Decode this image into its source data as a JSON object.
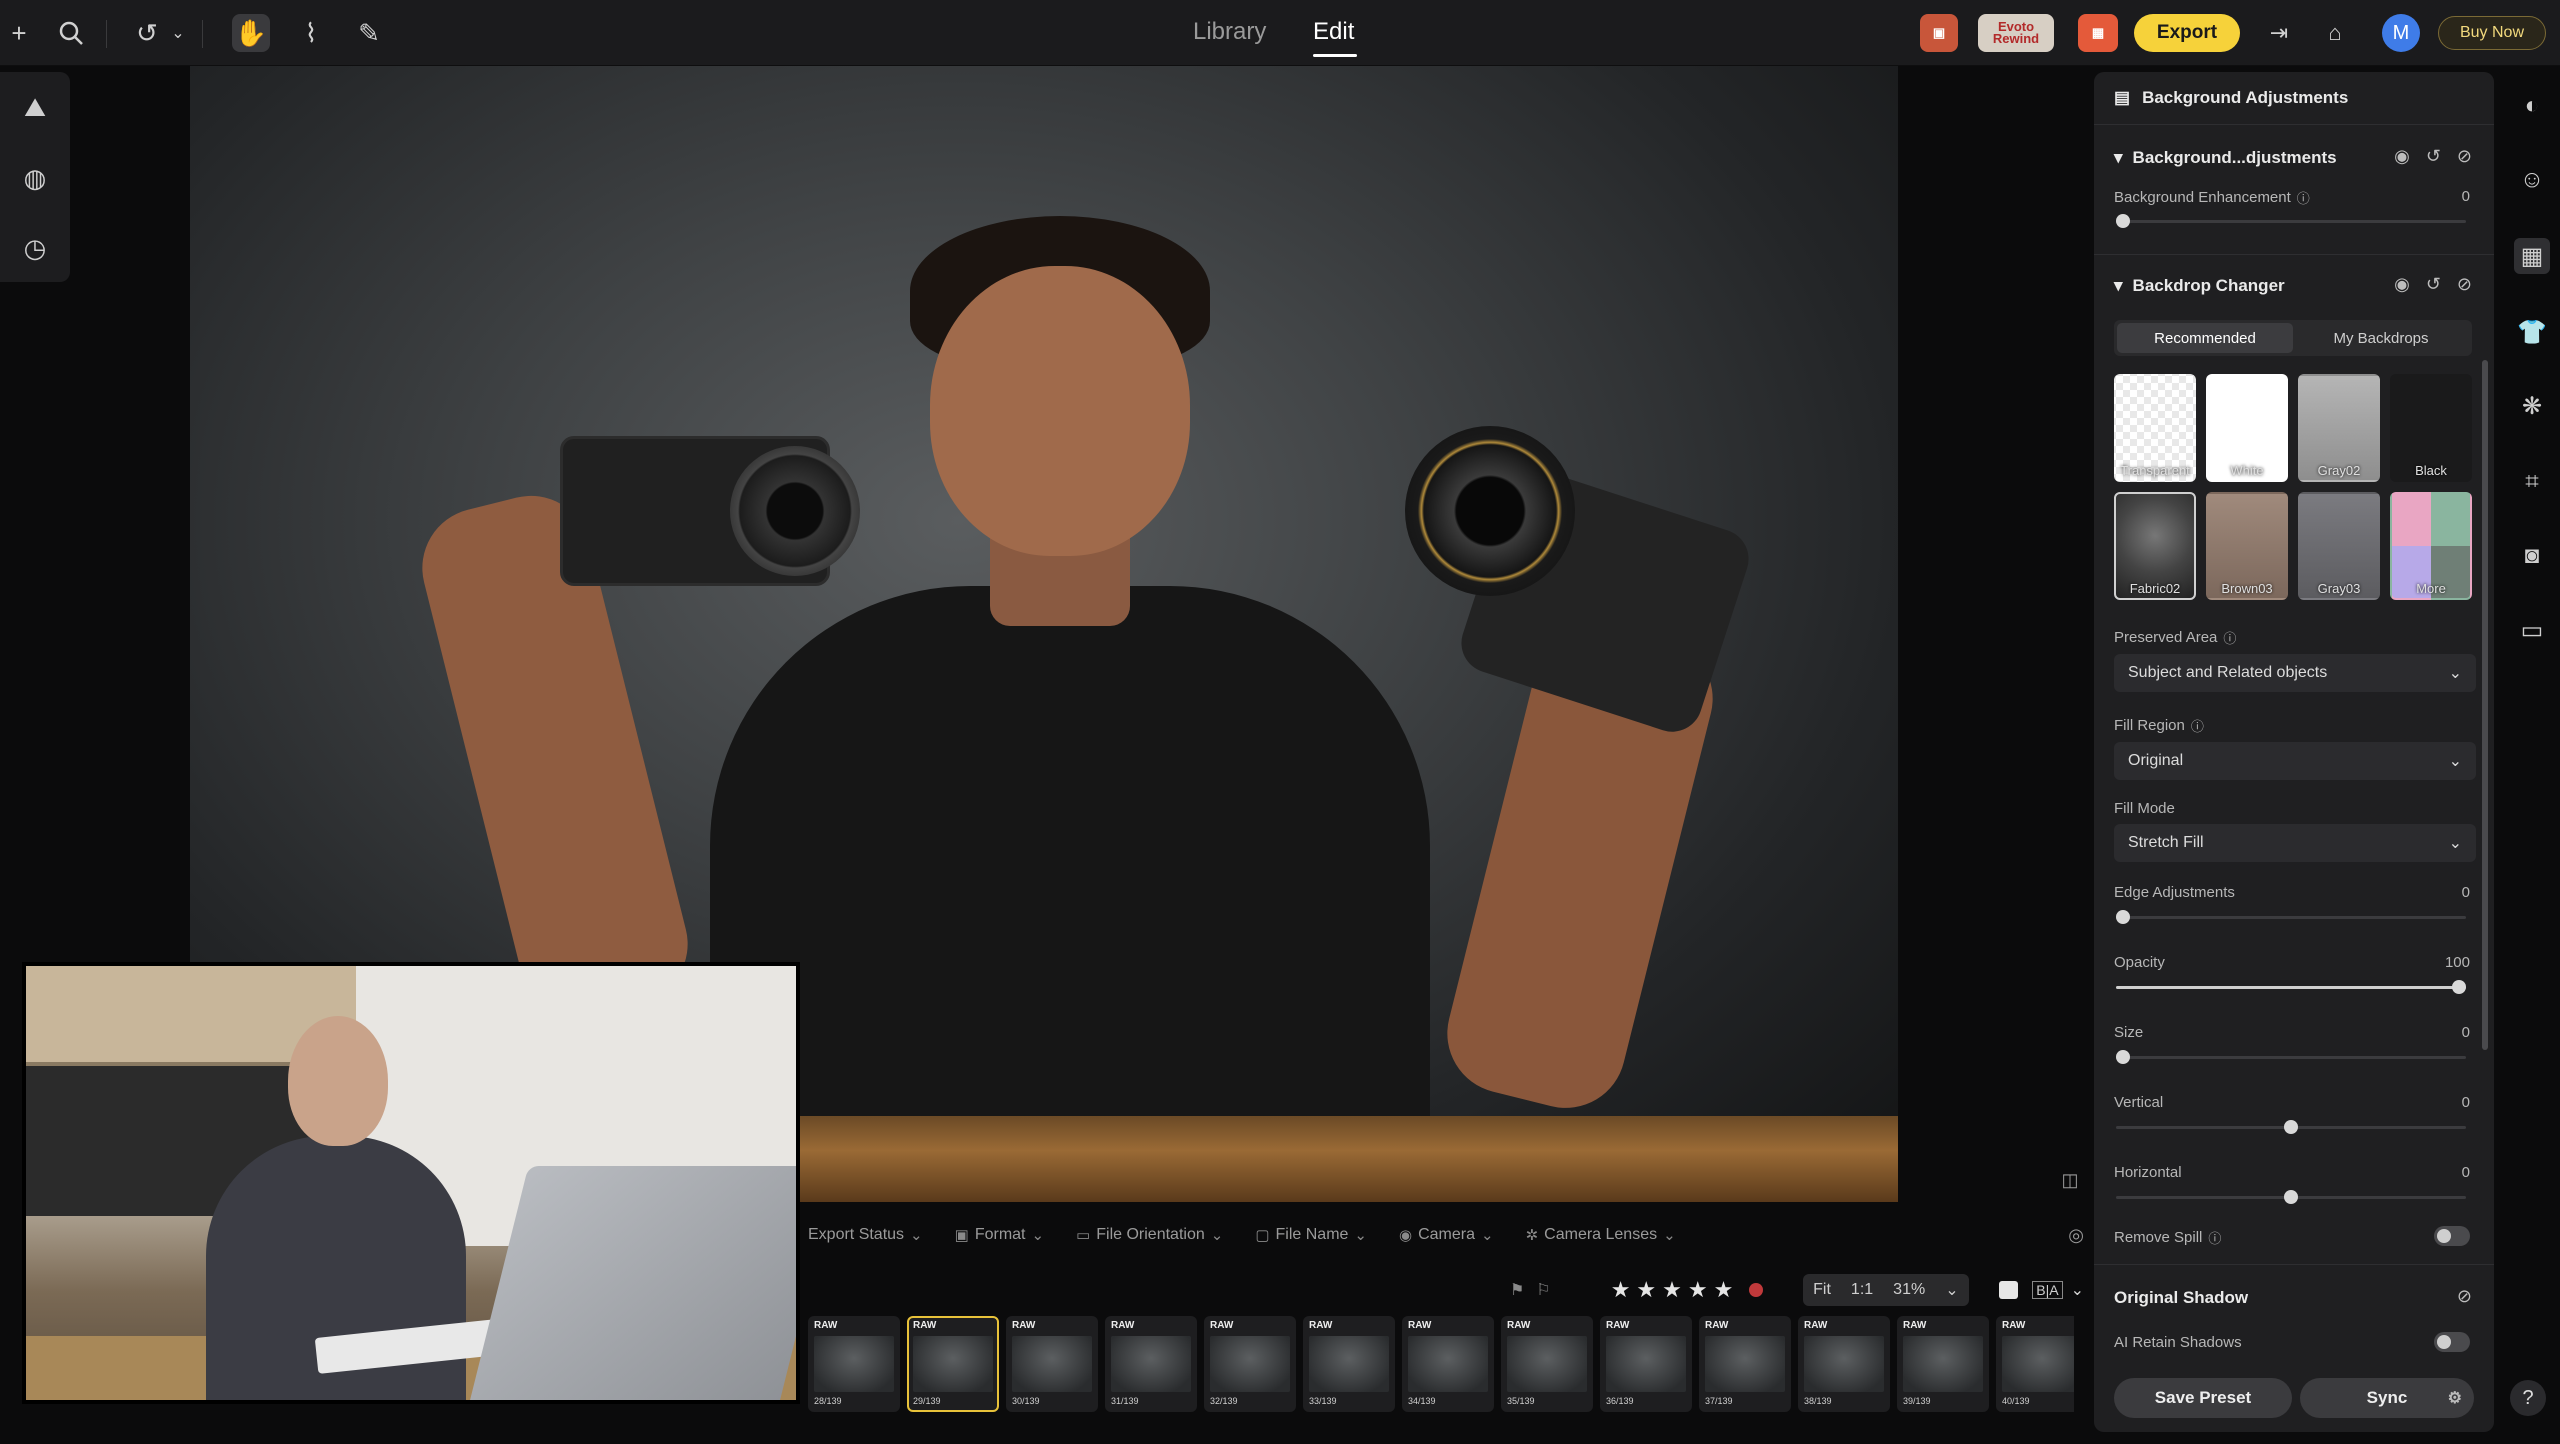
{
  "topbar": {
    "tabs": [
      {
        "label": "Library"
      },
      {
        "label": "Edit"
      }
    ],
    "promo_label": "Evoto Rewind",
    "export_label": "Export",
    "avatar_initial": "M",
    "buy_label": "Buy Now"
  },
  "filter_bar": {
    "items": [
      {
        "label": "Export Status"
      },
      {
        "label": "Format"
      },
      {
        "label": "File Orientation"
      },
      {
        "label": "File Name"
      },
      {
        "label": "Camera"
      },
      {
        "label": "Camera Lenses"
      }
    ]
  },
  "view": {
    "fit_label": "Fit",
    "one_to_one_label": "1:1",
    "zoom": "31%",
    "compare_label": "B|A",
    "rating_stars": 5
  },
  "filmstrip": {
    "raw_label": "RAW",
    "items": [
      {
        "index": "28/139"
      },
      {
        "index": "29/139"
      },
      {
        "index": "30/139"
      },
      {
        "index": "31/139"
      },
      {
        "index": "32/139"
      },
      {
        "index": "33/139"
      },
      {
        "index": "34/139"
      },
      {
        "index": "35/139"
      },
      {
        "index": "36/139"
      },
      {
        "index": "37/139"
      },
      {
        "index": "38/139"
      },
      {
        "index": "39/139"
      },
      {
        "index": "40/139"
      }
    ],
    "selected_index": "29/139"
  },
  "panel": {
    "title": "Background Adjustments",
    "section1": {
      "title": "Background...djustments",
      "background_enhancement_label": "Background Enhancement",
      "background_enhancement_value": "0"
    },
    "section2": {
      "title": "Backdrop Changer",
      "tabs": [
        {
          "label": "Recommended"
        },
        {
          "label": "My Backdrops"
        }
      ],
      "swatches": [
        {
          "label": "Transparent"
        },
        {
          "label": "White"
        },
        {
          "label": "Gray02"
        },
        {
          "label": "Black"
        },
        {
          "label": "Fabric02"
        },
        {
          "label": "Brown03"
        },
        {
          "label": "Gray03"
        },
        {
          "label": "More"
        }
      ],
      "preserved_area_label": "Preserved Area",
      "preserved_area_value": "Subject and Related objects",
      "fill_region_label": "Fill Region",
      "fill_region_value": "Original",
      "fill_mode_label": "Fill Mode",
      "fill_mode_value": "Stretch Fill",
      "edge_adjustments_label": "Edge Adjustments",
      "edge_adjustments_value": "0",
      "opacity_label": "Opacity",
      "opacity_value": "100",
      "size_label": "Size",
      "size_value": "0",
      "vertical_label": "Vertical",
      "vertical_value": "0",
      "horizontal_label": "Horizontal",
      "horizontal_value": "0",
      "remove_spill_label": "Remove Spill"
    },
    "section3": {
      "title": "Original Shadow",
      "ai_retain_label": "AI Retain Shadows"
    },
    "save_preset_label": "Save Preset",
    "sync_label": "Sync"
  }
}
